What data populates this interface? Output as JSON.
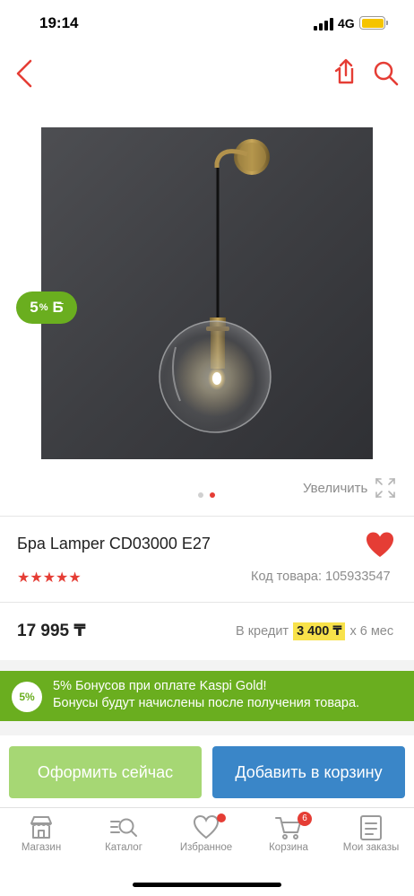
{
  "status_bar": {
    "time": "19:14",
    "network": "4G"
  },
  "product": {
    "title": "Бра Lamper CD03000 E27",
    "rating_stars": "★★★★★",
    "rating": 5,
    "sku_label": "Код товара: 105933547",
    "price": "17 995 ₸",
    "credit_label": "В кредит",
    "credit_amount": "3 400 ₸",
    "credit_term": "x 6 мес",
    "bonus_percent": "5",
    "bonus_percent_sign": "%",
    "bonus_currency": "Б",
    "image_count": 2,
    "active_image": 2
  },
  "gallery": {
    "zoom_label": "Увеличить"
  },
  "promo": {
    "badge": "5%",
    "line1": "5% Бонусов при оплате Kaspi Gold!",
    "line2": "Бонусы будут начислены после получения товара."
  },
  "actions": {
    "buy_now": "Оформить сейчас",
    "add_to_cart": "Добавить в корзину"
  },
  "tabs": [
    {
      "label": "Магазин",
      "icon": "shop-icon"
    },
    {
      "label": "Каталог",
      "icon": "catalog-icon"
    },
    {
      "label": "Избранное",
      "icon": "heart-icon",
      "has_dot": true
    },
    {
      "label": "Корзина",
      "icon": "cart-icon",
      "count": "6"
    },
    {
      "label": "Мои заказы",
      "icon": "orders-icon"
    }
  ],
  "colors": {
    "accent_red": "#e53d35",
    "kaspi_green": "#6aae1f",
    "buy_button": "#a6d774",
    "cart_button": "#3a86c8",
    "credit_highlight": "#f8e24a"
  }
}
